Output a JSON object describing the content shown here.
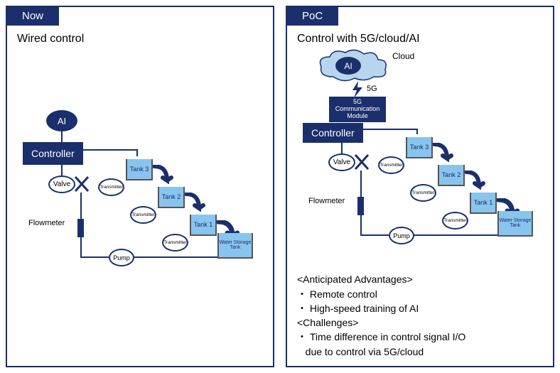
{
  "left": {
    "tab": "Now",
    "title": "Wired control",
    "ai": "AI",
    "controller": "Controller",
    "valve": "Valve",
    "flowmeter": "Flowmeter",
    "pump": "Pump",
    "transmitter": "Transmitter",
    "tank3": "Tank 3",
    "tank2": "Tank 2",
    "tank1": "Tank 1",
    "storage": "Water Storage Tank"
  },
  "right": {
    "tab": "PoC",
    "title": "Control with 5G/cloud/AI",
    "ai": "AI",
    "cloud": "Cloud",
    "fiveG": "5G",
    "comm1": "5G",
    "comm2": "Communication",
    "comm3": "Module",
    "controller": "Controller",
    "valve": "Valve",
    "flowmeter": "Flowmeter",
    "pump": "Pump",
    "transmitter": "Transmitter",
    "tank3": "Tank 3",
    "tank2": "Tank 2",
    "tank1": "Tank 1",
    "storage": "Water Storage Tank",
    "h1": "<Anticipated Advantages>",
    "b1": "・ Remote control",
    "b2": "・ High-speed training of AI",
    "h2": "<Challenges>",
    "b3": "・ Time difference in control signal I/O",
    "b4": "   due to control via 5G/cloud"
  }
}
